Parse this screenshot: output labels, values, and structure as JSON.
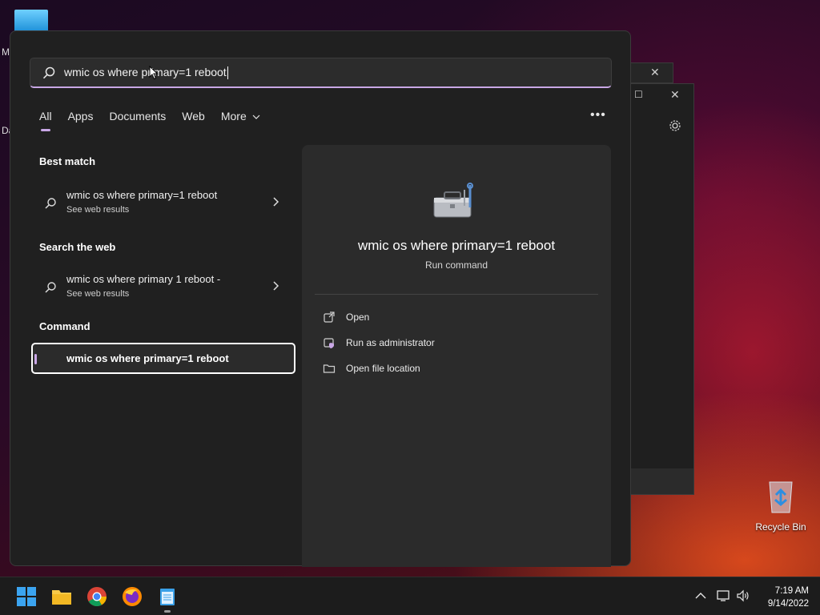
{
  "desktop": {
    "frag_m": "M",
    "frag_d": "Da",
    "recycle_bin_label": "Recycle Bin"
  },
  "search": {
    "query": "wmic os where primary=1 reboot"
  },
  "tabs": [
    {
      "label": "All",
      "active": true
    },
    {
      "label": "Apps"
    },
    {
      "label": "Documents"
    },
    {
      "label": "Web"
    },
    {
      "label": "More"
    }
  ],
  "more_options": "•••",
  "sections": {
    "best_match": "Best match",
    "search_web": "Search the web",
    "command": "Command"
  },
  "results": {
    "best_match": {
      "title": "wmic os where primary=1 reboot",
      "subtitle": "See web results"
    },
    "web": {
      "title": "wmic os where primary 1 reboot -",
      "subtitle": "See web results"
    },
    "command": {
      "title": "wmic os where primary=1 reboot"
    }
  },
  "detail": {
    "title": "wmic os where primary=1 reboot",
    "subtitle": "Run command",
    "actions": [
      {
        "label": "Open",
        "icon": "open-external-icon"
      },
      {
        "label": "Run as administrator",
        "icon": "shield-admin-icon"
      },
      {
        "label": "Open file location",
        "icon": "folder-icon"
      }
    ]
  },
  "clock": {
    "time": "7:19 AM",
    "date": "9/14/2022"
  },
  "colors": {
    "accent": "#c9a7e6",
    "panel": "#202020",
    "detail": "#2b2b2b"
  }
}
